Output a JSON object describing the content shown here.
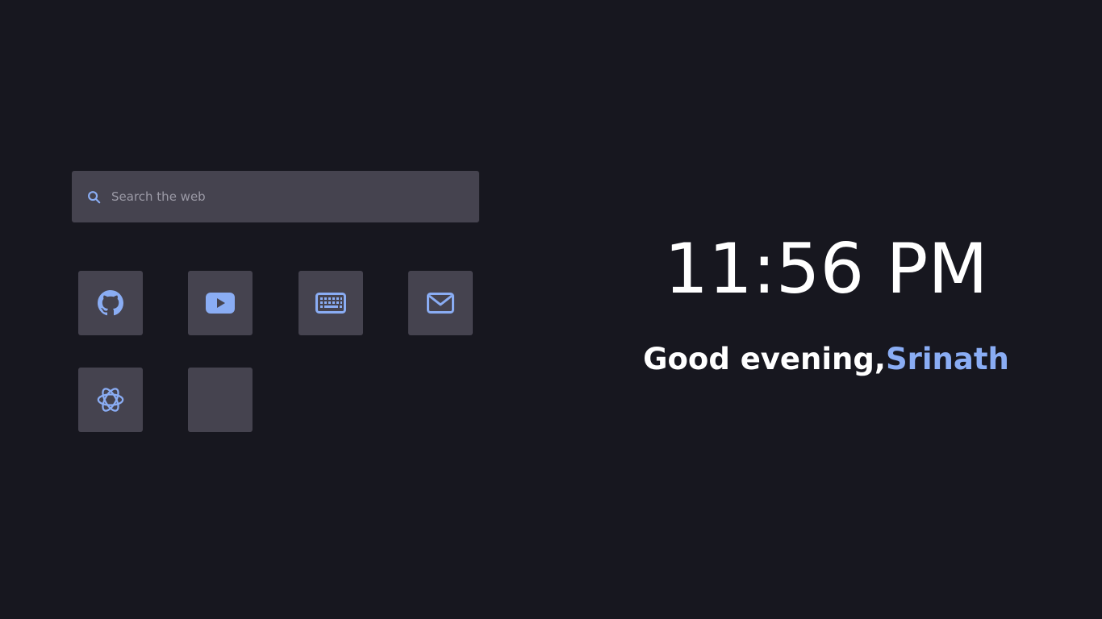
{
  "search": {
    "placeholder": "Search the web",
    "icon": "search-icon"
  },
  "shortcuts": [
    {
      "icon": "github-icon"
    },
    {
      "icon": "youtube-icon"
    },
    {
      "icon": "keyboard-icon"
    },
    {
      "icon": "mail-icon"
    },
    {
      "icon": "openai-icon"
    },
    {
      "icon": ""
    }
  ],
  "clock": {
    "time": "11:56 PM"
  },
  "greeting": {
    "text": "Good evening,",
    "name": "Srinath"
  },
  "colors": {
    "background": "#17171f",
    "tile": "#45434f",
    "accent": "#8aadf4",
    "text": "#ffffff"
  }
}
